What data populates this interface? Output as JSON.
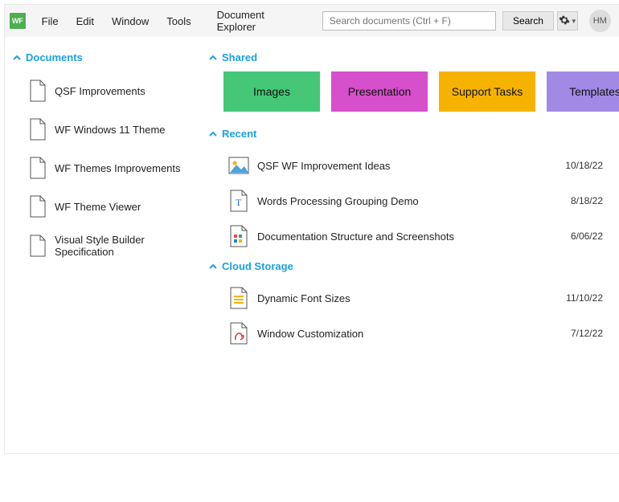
{
  "logo_text": "WF",
  "menubar": [
    "File",
    "Edit",
    "Window",
    "Tools"
  ],
  "title": "Document Explorer",
  "search": {
    "placeholder": "Search documents (Ctrl + F)",
    "button": "Search"
  },
  "avatar": "HM",
  "sidebar": {
    "header": "Documents",
    "items": [
      "QSF Improvements",
      "WF Windows 11 Theme",
      "WF Themes Improvements",
      "WF Theme Viewer",
      "Visual Style Builder Specification"
    ]
  },
  "shared": {
    "header": "Shared",
    "tiles": [
      "Images",
      "Presentation",
      "Support Tasks",
      "Templates"
    ]
  },
  "recent": {
    "header": "Recent",
    "items": [
      {
        "name": "QSF WF Improvement Ideas",
        "date": "10/18/22"
      },
      {
        "name": "Words Processing Grouping Demo",
        "date": "8/18/22"
      },
      {
        "name": "Documentation Structure and Screenshots",
        "date": "6/06/22"
      }
    ]
  },
  "cloud": {
    "header": "Cloud Storage",
    "items": [
      {
        "name": "Dynamic Font Sizes",
        "date": "11/10/22"
      },
      {
        "name": "Window Customization",
        "date": "7/12/22"
      }
    ]
  }
}
